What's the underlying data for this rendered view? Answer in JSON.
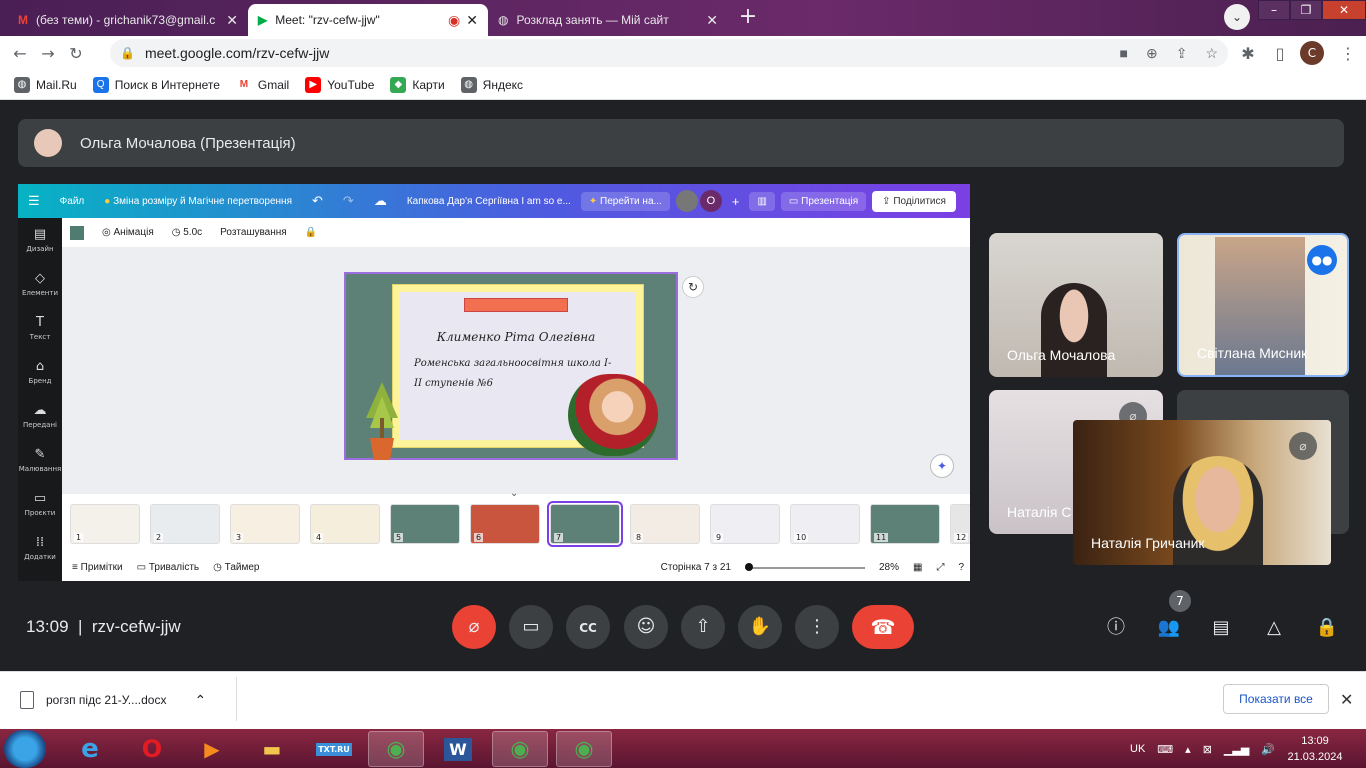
{
  "browser": {
    "tabs": [
      {
        "title": "(без теми) - grichanik73@gmail.c",
        "icon": "gmail-icon"
      },
      {
        "title": "Meet: \"rzv-cefw-jjw\"",
        "icon": "meet-icon"
      },
      {
        "title": "Розклад занять — Мій сайт",
        "icon": "globe-icon"
      }
    ],
    "url": "meet.google.com/rzv-cefw-jjw",
    "profile_initial": "C",
    "bookmarks": [
      "Mail.Ru",
      "Поиск в Интернете",
      "Gmail",
      "YouTube",
      "Карти",
      "Яндекс"
    ]
  },
  "meet": {
    "presenter_banner": "Ольга Мочалова (Презентація)",
    "time": "13:09",
    "meeting_code": "rzv-cefw-jjw",
    "participant_count": "7",
    "tiles": [
      {
        "name": "Ольга Мочалова"
      },
      {
        "name": "Світлана Мисник"
      },
      {
        "name": "Наталія С"
      },
      {
        "name": "Наталія Гричаник"
      }
    ]
  },
  "canva": {
    "menu": {
      "file": "Файл",
      "magic": "Зміна розміру й Магічне перетворення",
      "doc_title": "Капкова Дар'я Сергіївна I am so e...",
      "goto": "Перейти на...",
      "avatar_initial": "О",
      "present": "Презентація",
      "share": "Поділитися"
    },
    "side": [
      "Дизайн",
      "Елементи",
      "Текст",
      "Бренд",
      "Передані",
      "Малювання",
      "Проєкти",
      "Додатки"
    ],
    "toolbar": {
      "animation": "Анімація",
      "duration": "5.0с",
      "position": "Розташування"
    },
    "slide": {
      "name": "Клименко Ріта Олегівна",
      "school": "Роменська загальноосвітня школа І-ІІ ступенів №6"
    },
    "thumbnails": [
      "1",
      "2",
      "3",
      "4",
      "5",
      "6",
      "7",
      "8",
      "9",
      "10",
      "11",
      "12"
    ],
    "footer": {
      "notes": "Примітки",
      "duration": "Тривалість",
      "timer": "Таймер",
      "page": "Сторінка 7 з 21",
      "zoom": "28%"
    }
  },
  "downloads": {
    "file": "рогзп підс 21-У....docx",
    "show_all": "Показати все"
  },
  "taskbar": {
    "lang": "UK",
    "time": "13:09",
    "date": "21.03.2024",
    "tdt": "TXT.RU"
  }
}
